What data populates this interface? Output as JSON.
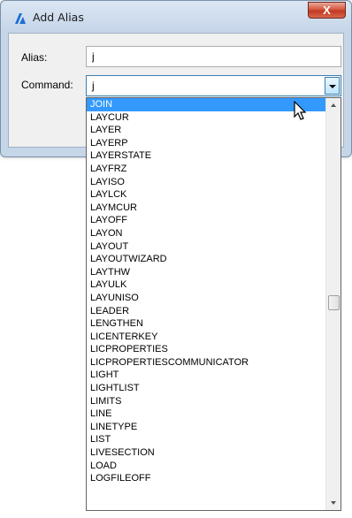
{
  "window": {
    "title": "Add Alias",
    "close_label": "X"
  },
  "form": {
    "alias_label": "Alias:",
    "alias_value": "j",
    "command_label": "Command:",
    "command_value": "j"
  },
  "dropdown": {
    "selected_index": 0,
    "items": [
      "JOIN",
      "LAYCUR",
      "LAYER",
      "LAYERP",
      "LAYERSTATE",
      "LAYFRZ",
      "LAYISO",
      "LAYLCK",
      "LAYMCUR",
      "LAYOFF",
      "LAYON",
      "LAYOUT",
      "LAYOUTWIZARD",
      "LAYTHW",
      "LAYULK",
      "LAYUNISO",
      "LEADER",
      "LENGTHEN",
      "LICENTERKEY",
      "LICPROPERTIES",
      "LICPROPERTIESCOMMUNICATOR",
      "LIGHT",
      "LIGHTLIST",
      "LIMITS",
      "LINE",
      "LINETYPE",
      "LIST",
      "LIVESECTION",
      "LOAD",
      "LOGFILEOFF"
    ]
  },
  "colors": {
    "selection": "#3399ff",
    "close_button": "#c94a32",
    "app_icon": "#1e6fd0"
  },
  "icons": {
    "app": "bricscad-logo-icon",
    "cursor": "mouse-pointer-icon"
  }
}
